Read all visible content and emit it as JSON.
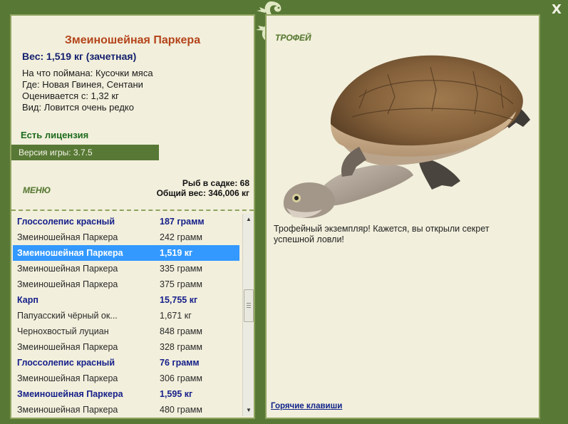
{
  "window": {
    "close_label": "X"
  },
  "catch_info": {
    "title": "Змеиношейная Паркера",
    "weight": "Вес: 1,519 кг (зачетная)",
    "bait": "На что поймана: Кусочки мяса",
    "location": "Где: Новая Гвинея, Сентани",
    "value": "Оценивается с: 1,32 кг",
    "rarity": "Вид: Ловится очень редко",
    "license": "Есть лицензия",
    "version": "Версия игры: 3.7.5"
  },
  "menu": {
    "label": "МЕНЮ"
  },
  "keepnet": {
    "fish_count": "Рыб в садке: 68",
    "total_weight": "Общий вес: 346,006 кг"
  },
  "fish_list": [
    {
      "name": "Глоссолепис красный",
      "weight": "187 грамм",
      "trophy": true,
      "selected": false
    },
    {
      "name": "Змеиношейная Паркера",
      "weight": "242 грамм",
      "trophy": false,
      "selected": false
    },
    {
      "name": "Змеиношейная Паркера",
      "weight": "1,519 кг",
      "trophy": true,
      "selected": true
    },
    {
      "name": "Змеиношейная Паркера",
      "weight": "335 грамм",
      "trophy": false,
      "selected": false
    },
    {
      "name": "Змеиношейная Паркера",
      "weight": "375 грамм",
      "trophy": false,
      "selected": false
    },
    {
      "name": "Карп",
      "weight": "15,755 кг",
      "trophy": true,
      "selected": false
    },
    {
      "name": "Папуасский чёрный ок...",
      "weight": "1,671 кг",
      "trophy": false,
      "selected": false
    },
    {
      "name": "Чернохвостый луциан",
      "weight": "848 грамм",
      "trophy": false,
      "selected": false
    },
    {
      "name": "Змеиношейная Паркера",
      "weight": "328 грамм",
      "trophy": false,
      "selected": false
    },
    {
      "name": "Глоссолепис красный",
      "weight": "76 грамм",
      "trophy": true,
      "selected": false
    },
    {
      "name": "Змеиношейная Паркера",
      "weight": "306 грамм",
      "trophy": false,
      "selected": false
    },
    {
      "name": "Змеиношейная Паркера",
      "weight": "1,595 кг",
      "trophy": true,
      "selected": false
    },
    {
      "name": "Змеиношейная Паркера",
      "weight": "480 грамм",
      "trophy": false,
      "selected": false
    }
  ],
  "trophy_panel": {
    "label": "ТРОФЕЙ",
    "message": "Трофейный экземпляр! Кажется, вы открыли секрет успешной ловли!",
    "hotkeys": "Горячие клавиши"
  },
  "colors": {
    "frame": "#587935",
    "panel": "#f2efdc",
    "title": "#b4441a",
    "trophy_text": "#16208a",
    "selection": "#3399ff",
    "license": "#1d6b1d"
  }
}
